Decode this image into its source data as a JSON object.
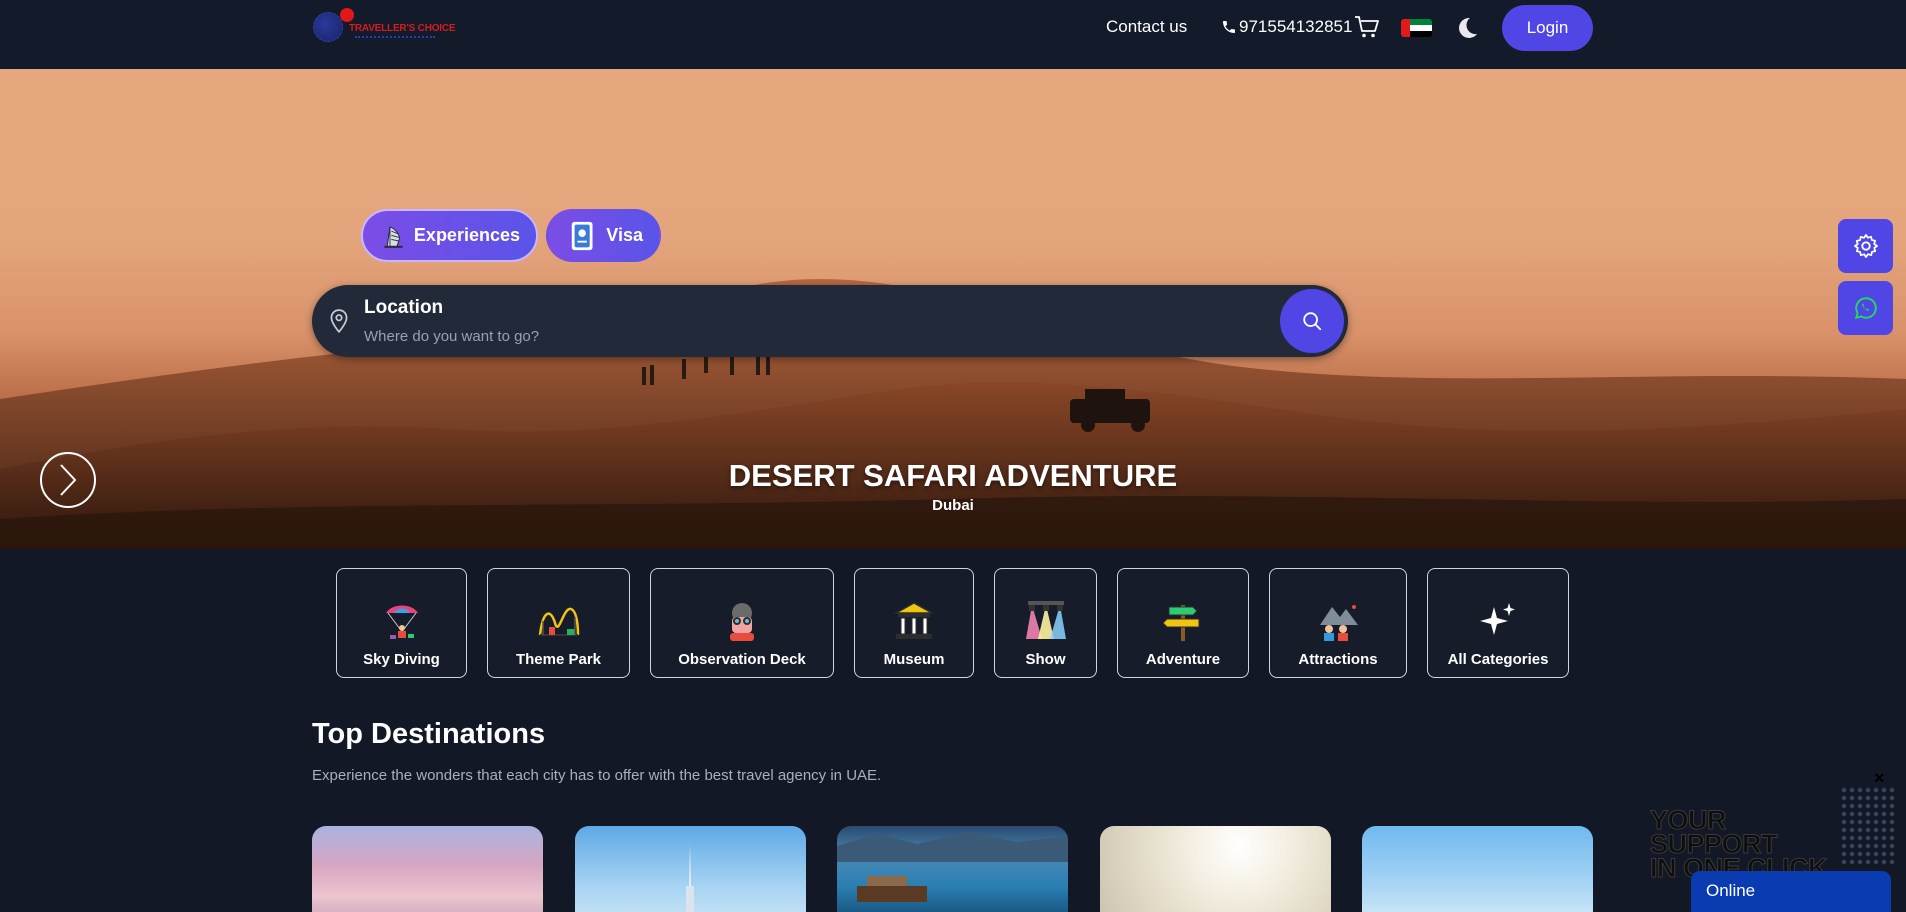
{
  "header": {
    "logo_text": "TRAVELLER'S CHOICE",
    "contact_label": "Contact us",
    "phone": "971554132851",
    "login_label": "Login"
  },
  "hero": {
    "tabs": [
      {
        "label": "Experiences",
        "icon": "burj-al-arab-icon"
      },
      {
        "label": "Visa",
        "icon": "passport-icon"
      }
    ],
    "search": {
      "label": "Location",
      "placeholder": "Where do you want to go?"
    },
    "slide_title": "DESERT SAFARI ADVENTURE",
    "slide_subtitle": "Dubai"
  },
  "categories": [
    {
      "label": "Sky Diving",
      "icon": "skydiving-icon"
    },
    {
      "label": "Theme Park",
      "icon": "roller-coaster-icon"
    },
    {
      "label": "Observation Deck",
      "icon": "binoculars-person-icon"
    },
    {
      "label": "Museum",
      "icon": "museum-icon"
    },
    {
      "label": "Show",
      "icon": "stage-lights-icon"
    },
    {
      "label": "Adventure",
      "icon": "signpost-icon"
    },
    {
      "label": "Attractions",
      "icon": "mountain-people-icon"
    },
    {
      "label": "All Categories",
      "icon": "sparkles-icon"
    }
  ],
  "destinations": {
    "title": "Top Destinations",
    "description": "Experience the wonders that each city has to offer with the best travel agency in UAE."
  },
  "support": {
    "line1": "YOUR SUPPORT",
    "line2": "IN ONE CLICK",
    "close": "×",
    "status": "Online"
  },
  "colors": {
    "accent": "#4f46e5",
    "background": "#121826",
    "online_bar": "#0a3bb0"
  }
}
